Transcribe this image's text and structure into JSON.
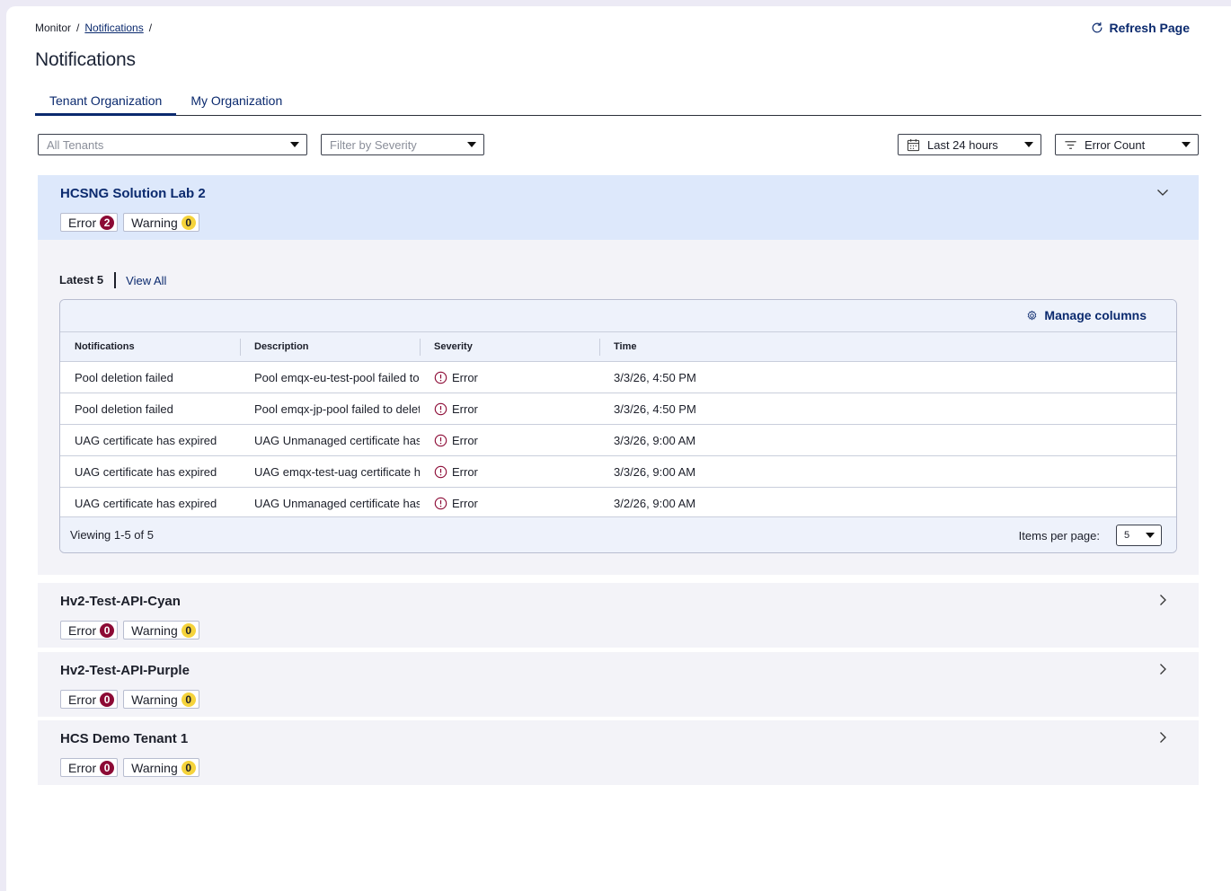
{
  "breadcrumb": {
    "root": "Monitor",
    "sep1": "/",
    "current": "Notifications",
    "sep2": "/"
  },
  "header": {
    "title": "Notifications",
    "refresh_label": "Refresh Page"
  },
  "tabs": [
    {
      "label": "Tenant Organization",
      "active": true
    },
    {
      "label": "My Organization",
      "active": false
    }
  ],
  "filters": {
    "tenants_placeholder": "All Tenants",
    "severity_placeholder": "Filter by Severity",
    "time_range": "Last 24 hours",
    "sort": "Error Count"
  },
  "groups": [
    {
      "name": "HCSNG Solution Lab 2",
      "expanded": true,
      "error_label": "Error",
      "error_count": "2",
      "warning_label": "Warning",
      "warning_count": "0",
      "subtabs": {
        "latest": "Latest 5",
        "view_all": "View All"
      },
      "manage_columns": "Manage columns",
      "columns": [
        "Notifications",
        "Description",
        "Severity",
        "Time"
      ],
      "rows": [
        {
          "notification": "Pool deletion failed",
          "description": "Pool emqx-eu-test-pool failed to delete.",
          "severity": "Error",
          "time": "3/3/26, 4:50 PM"
        },
        {
          "notification": "Pool deletion failed",
          "description": "Pool emqx-jp-pool failed to delete.",
          "severity": "Error",
          "time": "3/3/26, 4:50 PM"
        },
        {
          "notification": "UAG certificate has expired",
          "description": "UAG Unmanaged certificate has expired...",
          "severity": "Error",
          "time": "3/3/26, 9:00 AM"
        },
        {
          "notification": "UAG certificate has expired",
          "description": "UAG emqx-test-uag certificate has expire...",
          "severity": "Error",
          "time": "3/3/26, 9:00 AM"
        },
        {
          "notification": "UAG certificate has expired",
          "description": "UAG Unmanaged certificate has expired...",
          "severity": "Error",
          "time": "3/2/26, 9:00 AM"
        }
      ],
      "footer": {
        "viewing": "Viewing 1-5 of 5",
        "items_per_page_label": "Items per page:",
        "items_per_page": "5"
      }
    },
    {
      "name": "Hv2-Test-API-Cyan",
      "expanded": false,
      "error_label": "Error",
      "error_count": "0",
      "warning_label": "Warning",
      "warning_count": "0"
    },
    {
      "name": "Hv2-Test-API-Purple",
      "expanded": false,
      "error_label": "Error",
      "error_count": "0",
      "warning_label": "Warning",
      "warning_count": "0"
    },
    {
      "name": "HCS Demo Tenant 1",
      "expanded": false,
      "error_label": "Error",
      "error_count": "0",
      "warning_label": "Warning",
      "warning_count": "0"
    }
  ],
  "colors": {
    "accent": "#0b2a6e",
    "error": "#8c0a35",
    "warning": "#f5d33c",
    "expanded_header": "#dde8fb"
  },
  "icons": {
    "refresh": "refresh-icon",
    "calendar": "calendar-icon",
    "filter": "filter-icon",
    "gear": "gear-icon",
    "error": "error-circle-icon"
  }
}
